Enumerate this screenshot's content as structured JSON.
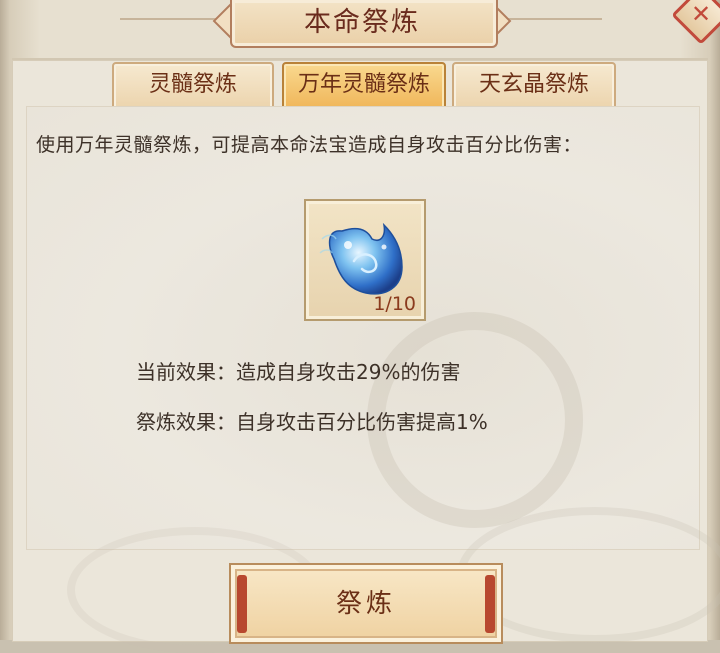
{
  "window": {
    "title": "本命祭炼"
  },
  "tabs": [
    {
      "label": "灵髓祭炼",
      "active": false
    },
    {
      "label": "万年灵髓祭炼",
      "active": true
    },
    {
      "label": "天玄晶祭炼",
      "active": false
    }
  ],
  "description": "使用万年灵髓祭炼，可提高本命法宝造成自身攻击百分比伤害：",
  "item": {
    "icon": "spirit-marrow-droplet-icon",
    "count": "1/10"
  },
  "effects": {
    "current_label": "当前效果：",
    "current_value": "造成自身攻击29%的伤害",
    "refine_label": "祭炼效果：",
    "refine_value": "自身攻击百分比伤害提高1%"
  },
  "actions": {
    "refine_button": "祭炼"
  },
  "colors": {
    "tab_active": "#f0b65a",
    "tab_inactive": "#ecd4ad",
    "title_text": "#6a2b1d",
    "close_accent": "#c24a3b"
  }
}
